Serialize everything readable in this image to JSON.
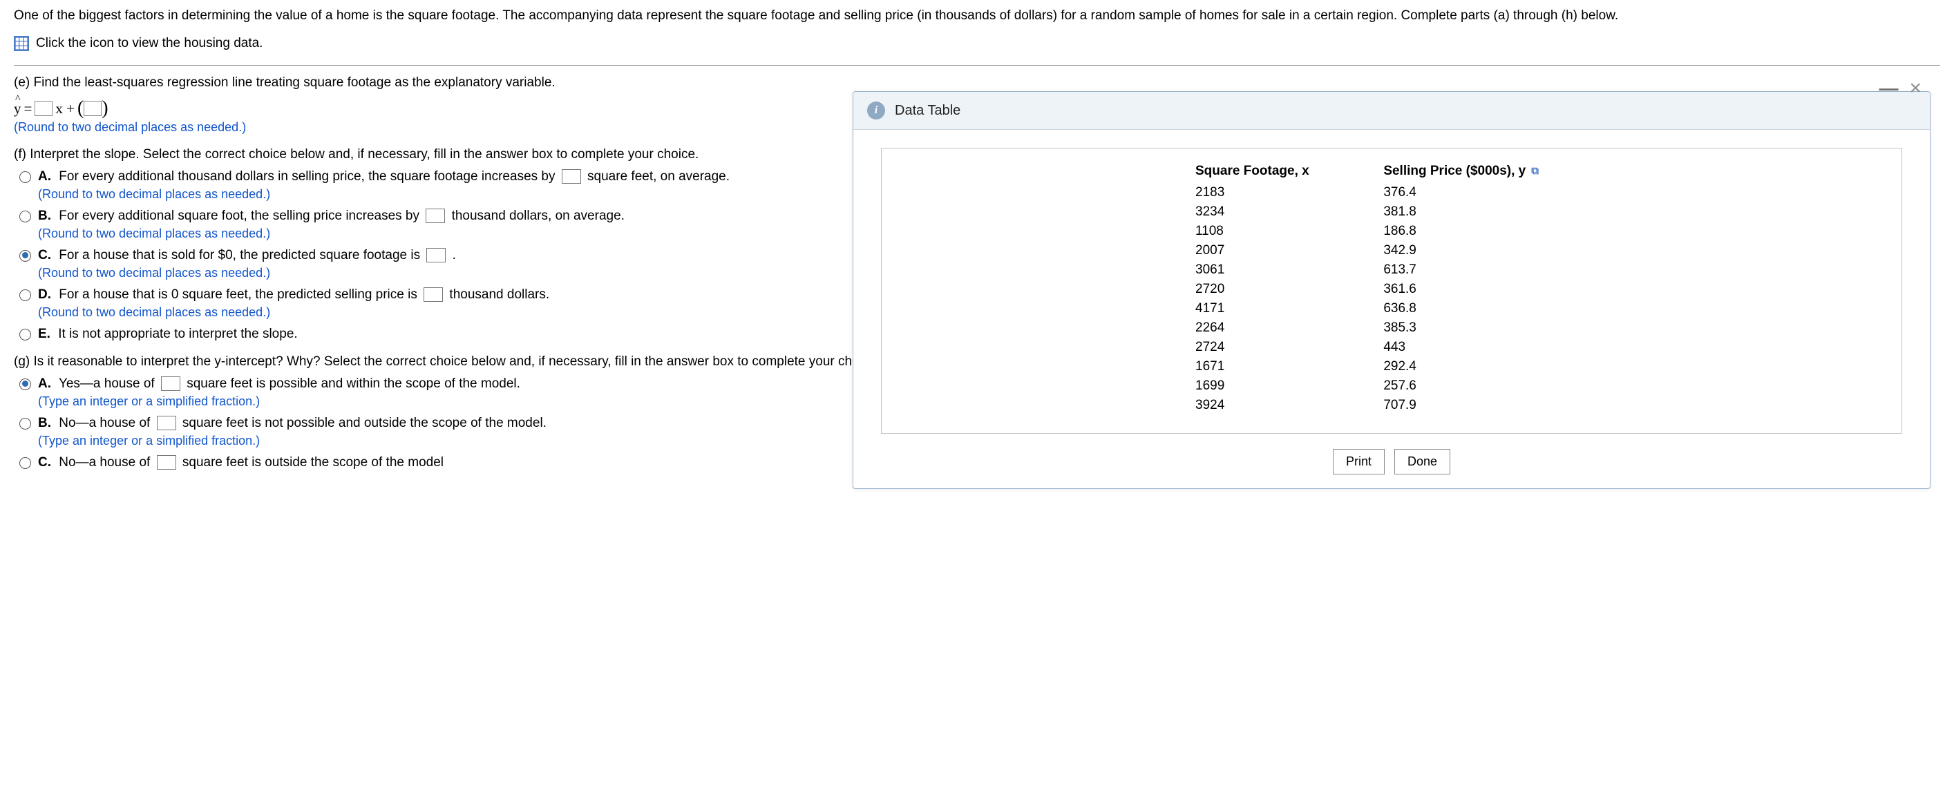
{
  "intro": "One of the biggest factors in determining the value of a home is the square footage. The accompanying data represent the square footage and selling price (in thousands of dollars) for a random sample of homes for sale in a certain region. Complete parts (a) through (h) below.",
  "data_link": "Click the icon to view the housing data.",
  "part_e": {
    "prompt": "(e) Find the least-squares regression line treating square footage as the explanatory variable.",
    "eq_left": "y =",
    "eq_mid": "x +",
    "hint": "(Round to two decimal places as needed.)"
  },
  "part_f": {
    "prompt": "(f) Interpret the slope. Select the correct choice below and, if necessary, fill in the answer box to complete your choice.",
    "choices": {
      "A": {
        "text_before": "For every additional thousand dollars in selling price, the square footage increases by",
        "text_after": "square feet, on average.",
        "hint": "(Round to two decimal places as needed.)"
      },
      "B": {
        "text_before": "For every additional square foot, the selling price increases by",
        "text_after": "thousand dollars, on average.",
        "hint": "(Round to two decimal places as needed.)"
      },
      "C": {
        "text_before": "For a house that is sold for $0, the predicted square footage is",
        "text_after": ".",
        "hint": "(Round to two decimal places as needed.)"
      },
      "D": {
        "text_before": "For a house that is 0 square feet, the predicted selling price is",
        "text_after": "thousand dollars.",
        "hint": "(Round to two decimal places as needed.)"
      },
      "E": {
        "text": "It is not appropriate to interpret the slope."
      }
    }
  },
  "part_g": {
    "prompt": "(g) Is it reasonable to interpret the y-intercept? Why? Select the correct choice below and, if necessary, fill in the answer box to complete your choice.",
    "choices": {
      "A": {
        "text_before": "Yes—a house of",
        "text_after": "square feet is possible and within the scope of the model.",
        "hint": "(Type an integer or a simplified fraction.)"
      },
      "B": {
        "text_before": "No—a house of",
        "text_after": "square feet is not possible and outside the scope of the model.",
        "hint": "(Type an integer or a simplified fraction.)"
      },
      "C": {
        "text_before": "No—a house of",
        "text_after": "square feet is outside the scope of the model"
      }
    }
  },
  "popup": {
    "title": "Data Table",
    "headers": {
      "x": "Square Footage, x",
      "y": "Selling Price ($000s), y"
    },
    "rows": [
      {
        "x": "2183",
        "y": "376.4"
      },
      {
        "x": "3234",
        "y": "381.8"
      },
      {
        "x": "1108",
        "y": "186.8"
      },
      {
        "x": "2007",
        "y": "342.9"
      },
      {
        "x": "3061",
        "y": "613.7"
      },
      {
        "x": "2720",
        "y": "361.6"
      },
      {
        "x": "4171",
        "y": "636.8"
      },
      {
        "x": "2264",
        "y": "385.3"
      },
      {
        "x": "2724",
        "y": "443"
      },
      {
        "x": "1671",
        "y": "292.4"
      },
      {
        "x": "1699",
        "y": "257.6"
      },
      {
        "x": "3924",
        "y": "707.9"
      }
    ],
    "buttons": {
      "print": "Print",
      "done": "Done"
    }
  }
}
